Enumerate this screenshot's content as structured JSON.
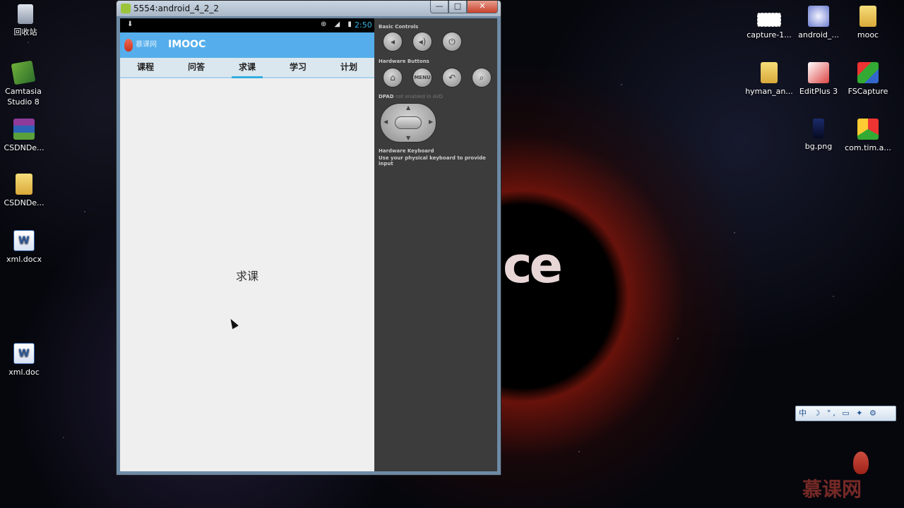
{
  "desktop": {
    "left_icons": [
      {
        "label": "回收站",
        "icon": "recycle-bin-icon"
      },
      {
        "label": "Camtasia Studio 8",
        "icon": "camtasia-icon"
      },
      {
        "label": "CSDNDe...",
        "icon": "winrar-icon"
      },
      {
        "label": "CSDNDe...",
        "icon": "folder-icon"
      },
      {
        "label": "xml.docx",
        "icon": "word-doc-icon"
      },
      {
        "label": "xml.doc",
        "icon": "word-doc-icon"
      }
    ],
    "right_icons": [
      {
        "label": "capture-1...",
        "icon": "capture-image-icon"
      },
      {
        "label": "android_...",
        "icon": "android-shortcut-icon"
      },
      {
        "label": "mooc",
        "icon": "folder-icon"
      },
      {
        "label": "hyman_an...",
        "icon": "folder-icon"
      },
      {
        "label": "EditPlus 3",
        "icon": "editplus-icon"
      },
      {
        "label": "FSCapture",
        "icon": "fscapture-icon"
      },
      {
        "label": "bg.png",
        "icon": "png-file-icon"
      },
      {
        "label": "com.tim.a...",
        "icon": "apk-icon"
      }
    ],
    "ime_bar": "中 ☽ °, ▭ ✦ ⚙",
    "watermark": "慕课网"
  },
  "emulator_window": {
    "title": "5554:android_4_2_2",
    "minimize_label": "—",
    "maximize_label": "□",
    "close_label": "✕"
  },
  "phone": {
    "status_bar": {
      "time": "2:50",
      "download_glyph": "⬇",
      "icons_glyph": "⊕ ◢ ▮"
    },
    "action_bar": {
      "logo_text": "慕课网",
      "title": "IMOOC"
    },
    "tabs": [
      "课程",
      "问答",
      "求课",
      "学习",
      "计划"
    ],
    "active_tab": "求课",
    "content_text": "求课"
  },
  "controls": {
    "basic_title": "Basic Controls",
    "basic_buttons": [
      "volume-down-icon",
      "volume-up-icon",
      "power-icon"
    ],
    "hardware_title": "Hardware Buttons",
    "hardware_buttons": [
      "home-icon",
      "menu-button",
      "back-icon",
      "search-icon"
    ],
    "menu_label": "MENU",
    "dpad_title": "DPAD",
    "dpad_note": "not enabled in AVD",
    "keyboard_title": "Hardware Keyboard",
    "keyboard_desc": "Use your physical keyboard to provide input"
  }
}
